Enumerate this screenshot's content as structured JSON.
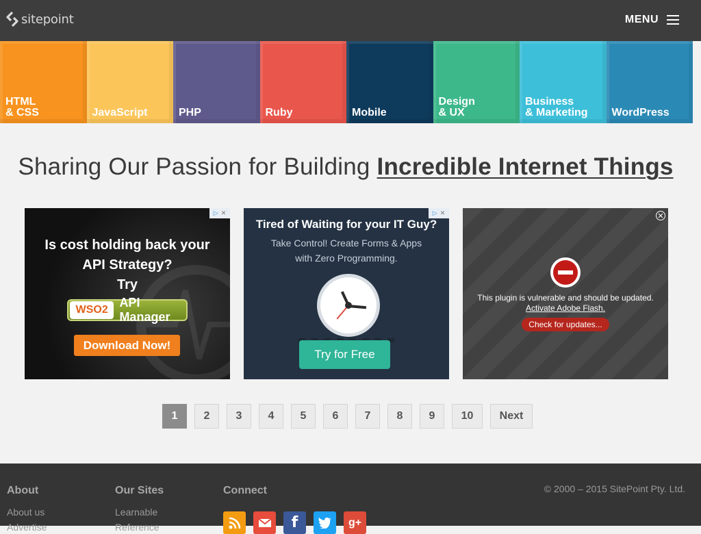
{
  "header": {
    "logo_text": "sitepoint",
    "menu_label": "MENU"
  },
  "categories": [
    {
      "label": "HTML\n& CSS",
      "color": "#f7931e"
    },
    {
      "label": "JavaScript",
      "color": "#fbc55a"
    },
    {
      "label": "PHP",
      "color": "#5f5a8c"
    },
    {
      "label": "Ruby",
      "color": "#e9564b"
    },
    {
      "label": "Mobile",
      "color": "#0e3a5c"
    },
    {
      "label": "Design\n& UX",
      "color": "#3db88b"
    },
    {
      "label": "Business\n& Marketing",
      "color": "#3dbfd9"
    },
    {
      "label": "WordPress",
      "color": "#2b8ab5"
    }
  ],
  "headline": {
    "plain": "Sharing Our Passion for Building ",
    "emphasis": "Incredible Internet Things"
  },
  "ads": {
    "ad1": {
      "line1": "Is cost holding back your",
      "line2": "API Strategy?",
      "line3": "Try",
      "logo_text": "WSO2",
      "product": "API Manager",
      "button": "Download Now!"
    },
    "ad2": {
      "title": "Tired of Waiting for your IT Guy?",
      "sub1": "Take Control! Create Forms & Apps",
      "sub2": "with Zero Programming.",
      "button": "Try for Free"
    },
    "ad3": {
      "message": "This plugin is vulnerable and should be updated.",
      "link": "Activate Adobe Flash.",
      "button": "Check for updates..."
    }
  },
  "pagination": {
    "pages": [
      "1",
      "2",
      "3",
      "4",
      "5",
      "6",
      "7",
      "8",
      "9",
      "10"
    ],
    "current": "1",
    "next_label": "Next"
  },
  "footer": {
    "about_title": "About",
    "about_link": "About us",
    "about_link2": "Advertise",
    "sites_title": "Our Sites",
    "sites_link": "Learnable",
    "sites_link2": "Reference",
    "connect_title": "Connect",
    "copyright": "© 2000 – 2015 SitePoint Pty. Ltd."
  }
}
